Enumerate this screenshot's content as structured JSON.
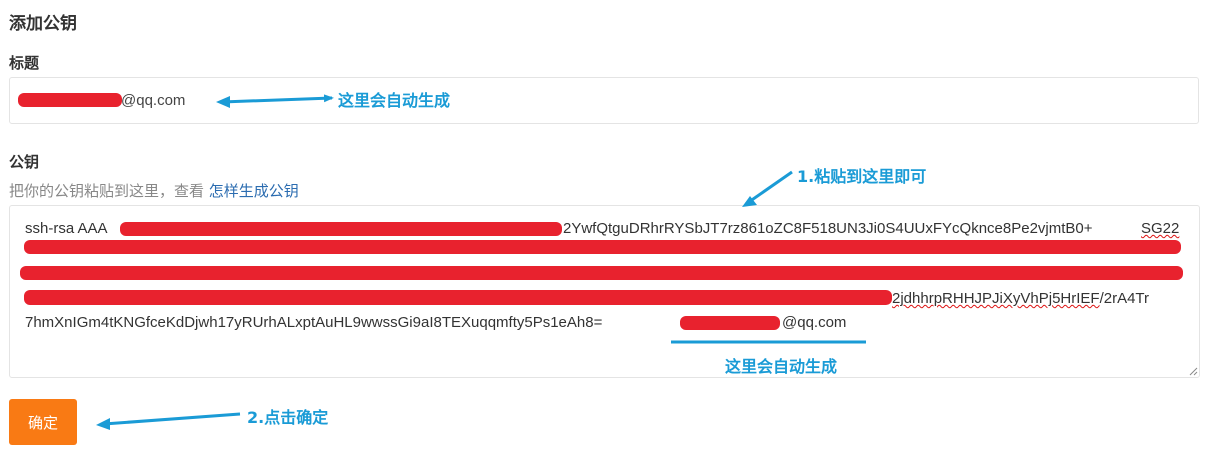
{
  "page": {
    "title": "添加公钥"
  },
  "title_field": {
    "label": "标题",
    "value_suffix": "@qq.com"
  },
  "key_field": {
    "label": "公钥",
    "hint_prefix": "把你的公钥粘贴到这里，查看 ",
    "hint_link": "怎样生成公钥",
    "line1_visible": "ssh-rsa AAA",
    "line1_end": "2YwfQtguDRhrRYSbJT7rz861oZC8F518UN3Ji0S4UUxFYcQknce8Pe2vjmtB0+",
    "line1_underlined": "SG22",
    "line5_end_a": "2jdhhrpRHHJPJiXyVhPj5HrIEF",
    "line5_end_b": "/2rA4Tr",
    "line6_text": "7hmXnIGm4tKNGfceKdDjwh17yRUrhALxptAuHL9wwssGi9aI8TEXuqqmfty5Ps1eAh8=",
    "line6_suffix": "@qq.com"
  },
  "buttons": {
    "confirm": "确定"
  },
  "annotations": {
    "auto_generated_title": "这里会自动生成",
    "paste_here": "1.粘贴到这里即可",
    "auto_generated_key": "这里会自动生成",
    "click_confirm": "2.点击确定"
  },
  "colors": {
    "annotation": "#1a9bd6",
    "redaction": "#e8222e",
    "confirm_button": "#f97a14"
  }
}
